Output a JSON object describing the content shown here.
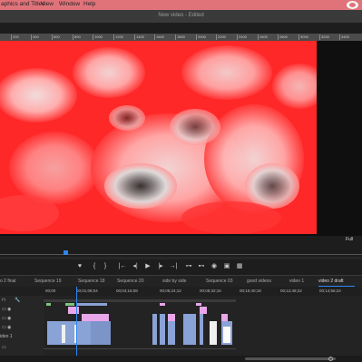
{
  "menu": {
    "items": [
      "aphics and Titles",
      "View",
      "Window",
      "Help"
    ]
  },
  "window": {
    "title": "New video - Edited"
  },
  "ruler": {
    "ticks": [
      "200",
      "400",
      "600",
      "800",
      "1000",
      "1200",
      "1400",
      "1600",
      "1800",
      "2000",
      "2200",
      "2400",
      "2600",
      "2800",
      "3000",
      "3200",
      "3400"
    ]
  },
  "program_monitor": {
    "fit_label": "Full"
  },
  "transport": {
    "buttons": [
      "marker-icon",
      "in-point-icon",
      "out-point-icon",
      "go-to-in-icon",
      "step-back-icon",
      "play-icon",
      "step-forward-icon",
      "go-to-out-icon",
      "insert-icon",
      "overwrite-icon",
      "export-frame-icon",
      "comparison-icon",
      "settings-icon"
    ]
  },
  "sequences": {
    "tabs": [
      "o 2 final",
      "Sequence 19",
      "Sequence 18",
      "Sequence 20",
      "side by side",
      "Sequence 03",
      "good videos",
      "video 1",
      "video 2 draft"
    ],
    "active": "video 2 draft"
  },
  "timecodes": [
    "00;00",
    "00;01;08;04",
    "00;04;16;08",
    "00;06;24;12",
    "00;08;32;16",
    "00;10;40;18",
    "00;12;48;22",
    "00;14;56;24"
  ],
  "tracks": {
    "label_v1": "ideo 1"
  },
  "colors": {
    "menubar": "#e0737a",
    "accent": "#2f86f0",
    "clip_blue": "#8aa3d6",
    "clip_pink": "#e9a6e9",
    "clip_green": "#7bc67b"
  }
}
